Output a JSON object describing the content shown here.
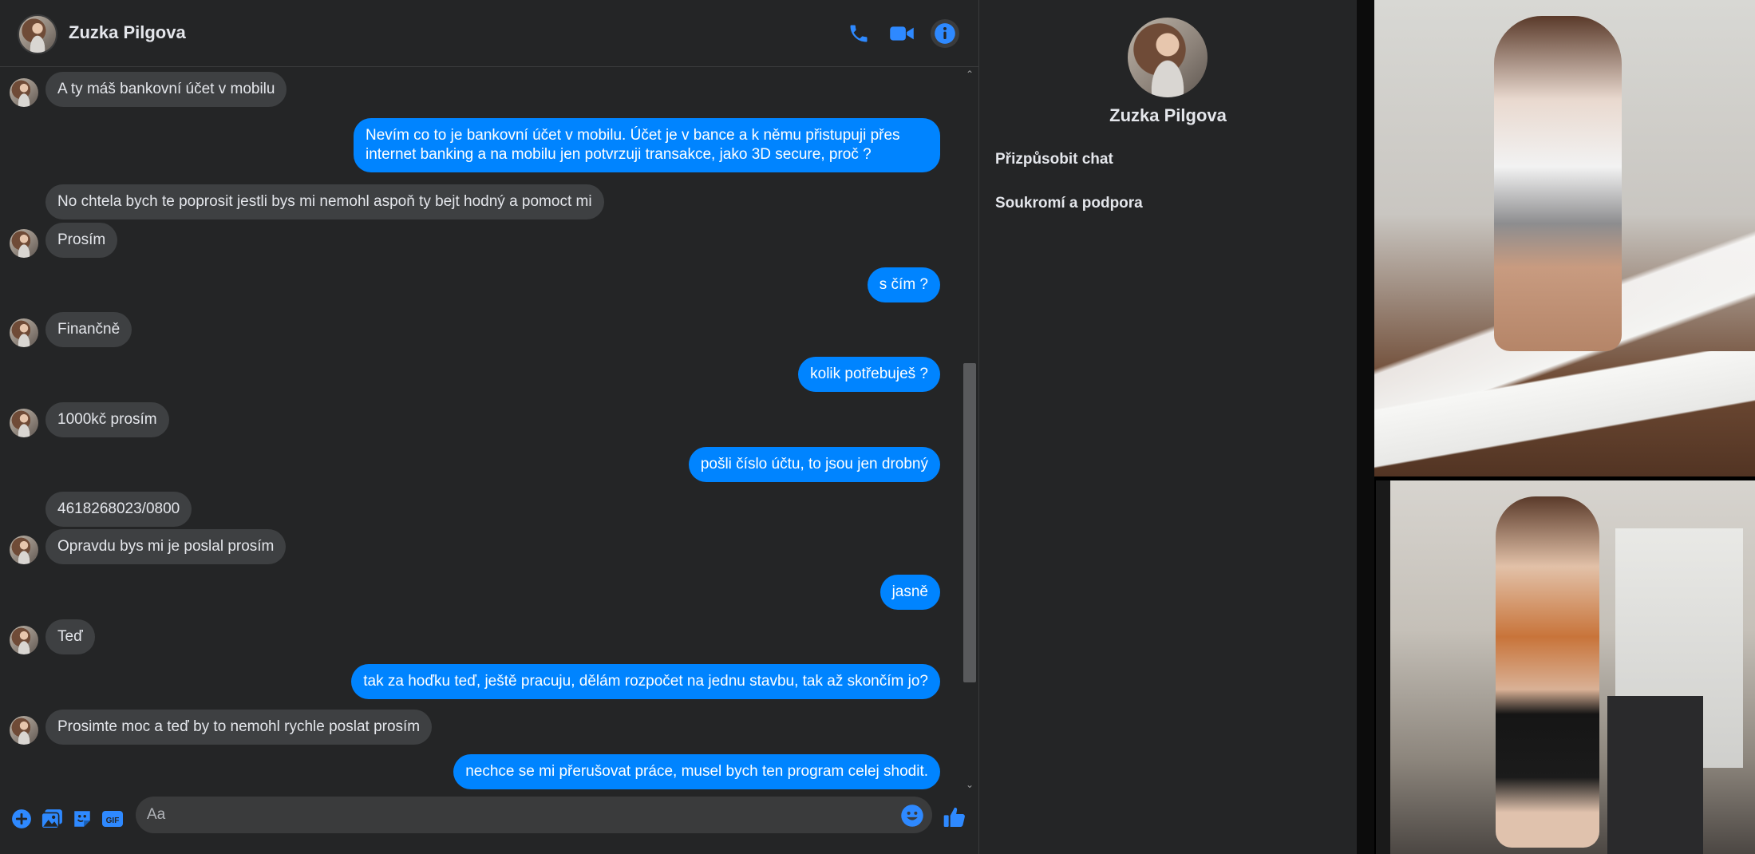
{
  "contact": {
    "name": "Zuzka Pilgova"
  },
  "header": {
    "icons": [
      "phone-icon",
      "video-icon",
      "info-icon"
    ]
  },
  "messages": [
    {
      "from": "them",
      "text": "A ty máš bankovní účet v mobilu",
      "avatar": true
    },
    {
      "from": "me",
      "text": "Nevím co to je bankovní účet v mobilu. Účet je v bance a k němu přistupuji přes internet banking a na mobilu jen potvrzuji transakce, jako 3D secure, proč ?"
    },
    {
      "from": "them",
      "text": "No chtela bych te poprosit jestli bys mi nemohl aspoň ty bejt hodný a pomoct mi",
      "avatar": false
    },
    {
      "from": "them",
      "text": "Prosím",
      "avatar": true
    },
    {
      "from": "me",
      "text": "s čím ?"
    },
    {
      "from": "them",
      "text": "Finančně",
      "avatar": true
    },
    {
      "from": "me",
      "text": "kolik potřebuješ ?"
    },
    {
      "from": "them",
      "text": "1000kč prosím",
      "avatar": true
    },
    {
      "from": "me",
      "text": "pošli číslo účtu, to jsou jen drobný"
    },
    {
      "from": "them",
      "text": "4618268023/0800",
      "avatar": false
    },
    {
      "from": "them",
      "text": "Opravdu bys mi je poslal prosím",
      "avatar": true
    },
    {
      "from": "me",
      "text": "jasně"
    },
    {
      "from": "them",
      "text": "Teď",
      "avatar": true
    },
    {
      "from": "me",
      "text": "tak za hoďku teď, ještě pracuju, dělám rozpočet na jednu stavbu, tak až skončím jo?"
    },
    {
      "from": "them",
      "text": "Prosimte  moc a teď by to nemohl rychle poslat prosím",
      "avatar": true
    },
    {
      "from": "me",
      "text": "nechce se mi přerušovat práce, musel bych ten program celej shodit."
    }
  ],
  "composer": {
    "placeholder": "Aa",
    "icons": [
      "plus-icon",
      "image-icon",
      "sticker-icon",
      "gif-icon",
      "emoji-icon",
      "like-icon"
    ]
  },
  "info_panel": {
    "name": "Zuzka Pilgova",
    "items": [
      "Přizpůsobit chat",
      "Soukromí a podpora"
    ]
  },
  "colors": {
    "accent": "#0084ff",
    "background": "#242526",
    "incoming_bubble": "#3e4042"
  }
}
